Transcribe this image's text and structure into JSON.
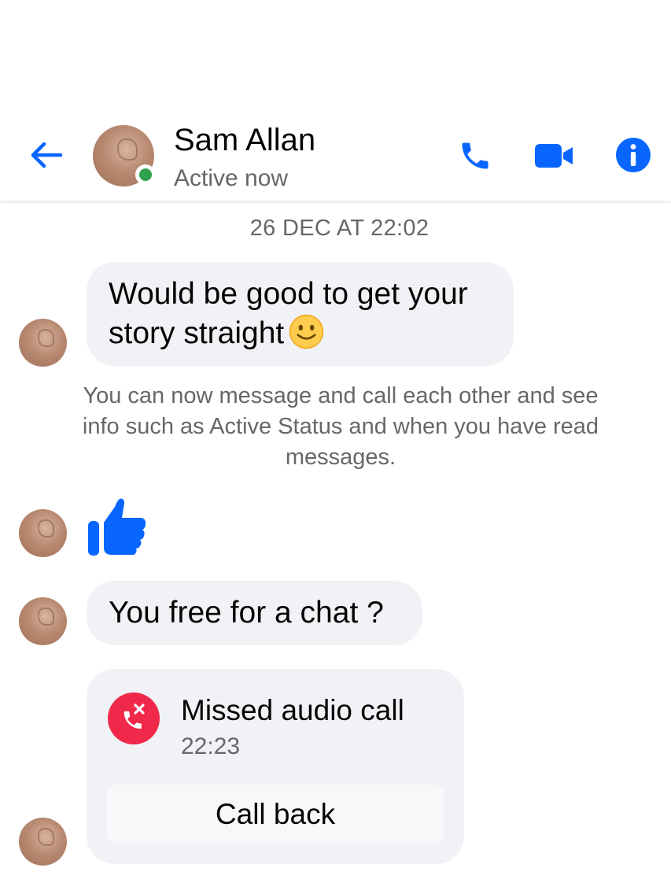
{
  "header": {
    "contact_name": "Sam Allan",
    "status": "Active now",
    "accent_color": "#0866ff",
    "online_color": "#31a24c",
    "icons": [
      "back-arrow-icon",
      "phone-icon",
      "video-camera-icon",
      "info-icon"
    ]
  },
  "conversation": {
    "timestamp": "26 DEC AT 22:02",
    "messages": [
      {
        "text": "Would be good to get your story straight",
        "emoji": "slightly-smiling-face"
      },
      {
        "text": "You free for a chat ?"
      }
    ],
    "system_note": "You can now message and call each other and see info such as Active Status and when you have read messages.",
    "reaction": "thumbs-up-icon",
    "call": {
      "title": "Missed audio call",
      "time": "22:23",
      "action_label": "Call back",
      "missed_color": "#f02849"
    }
  }
}
